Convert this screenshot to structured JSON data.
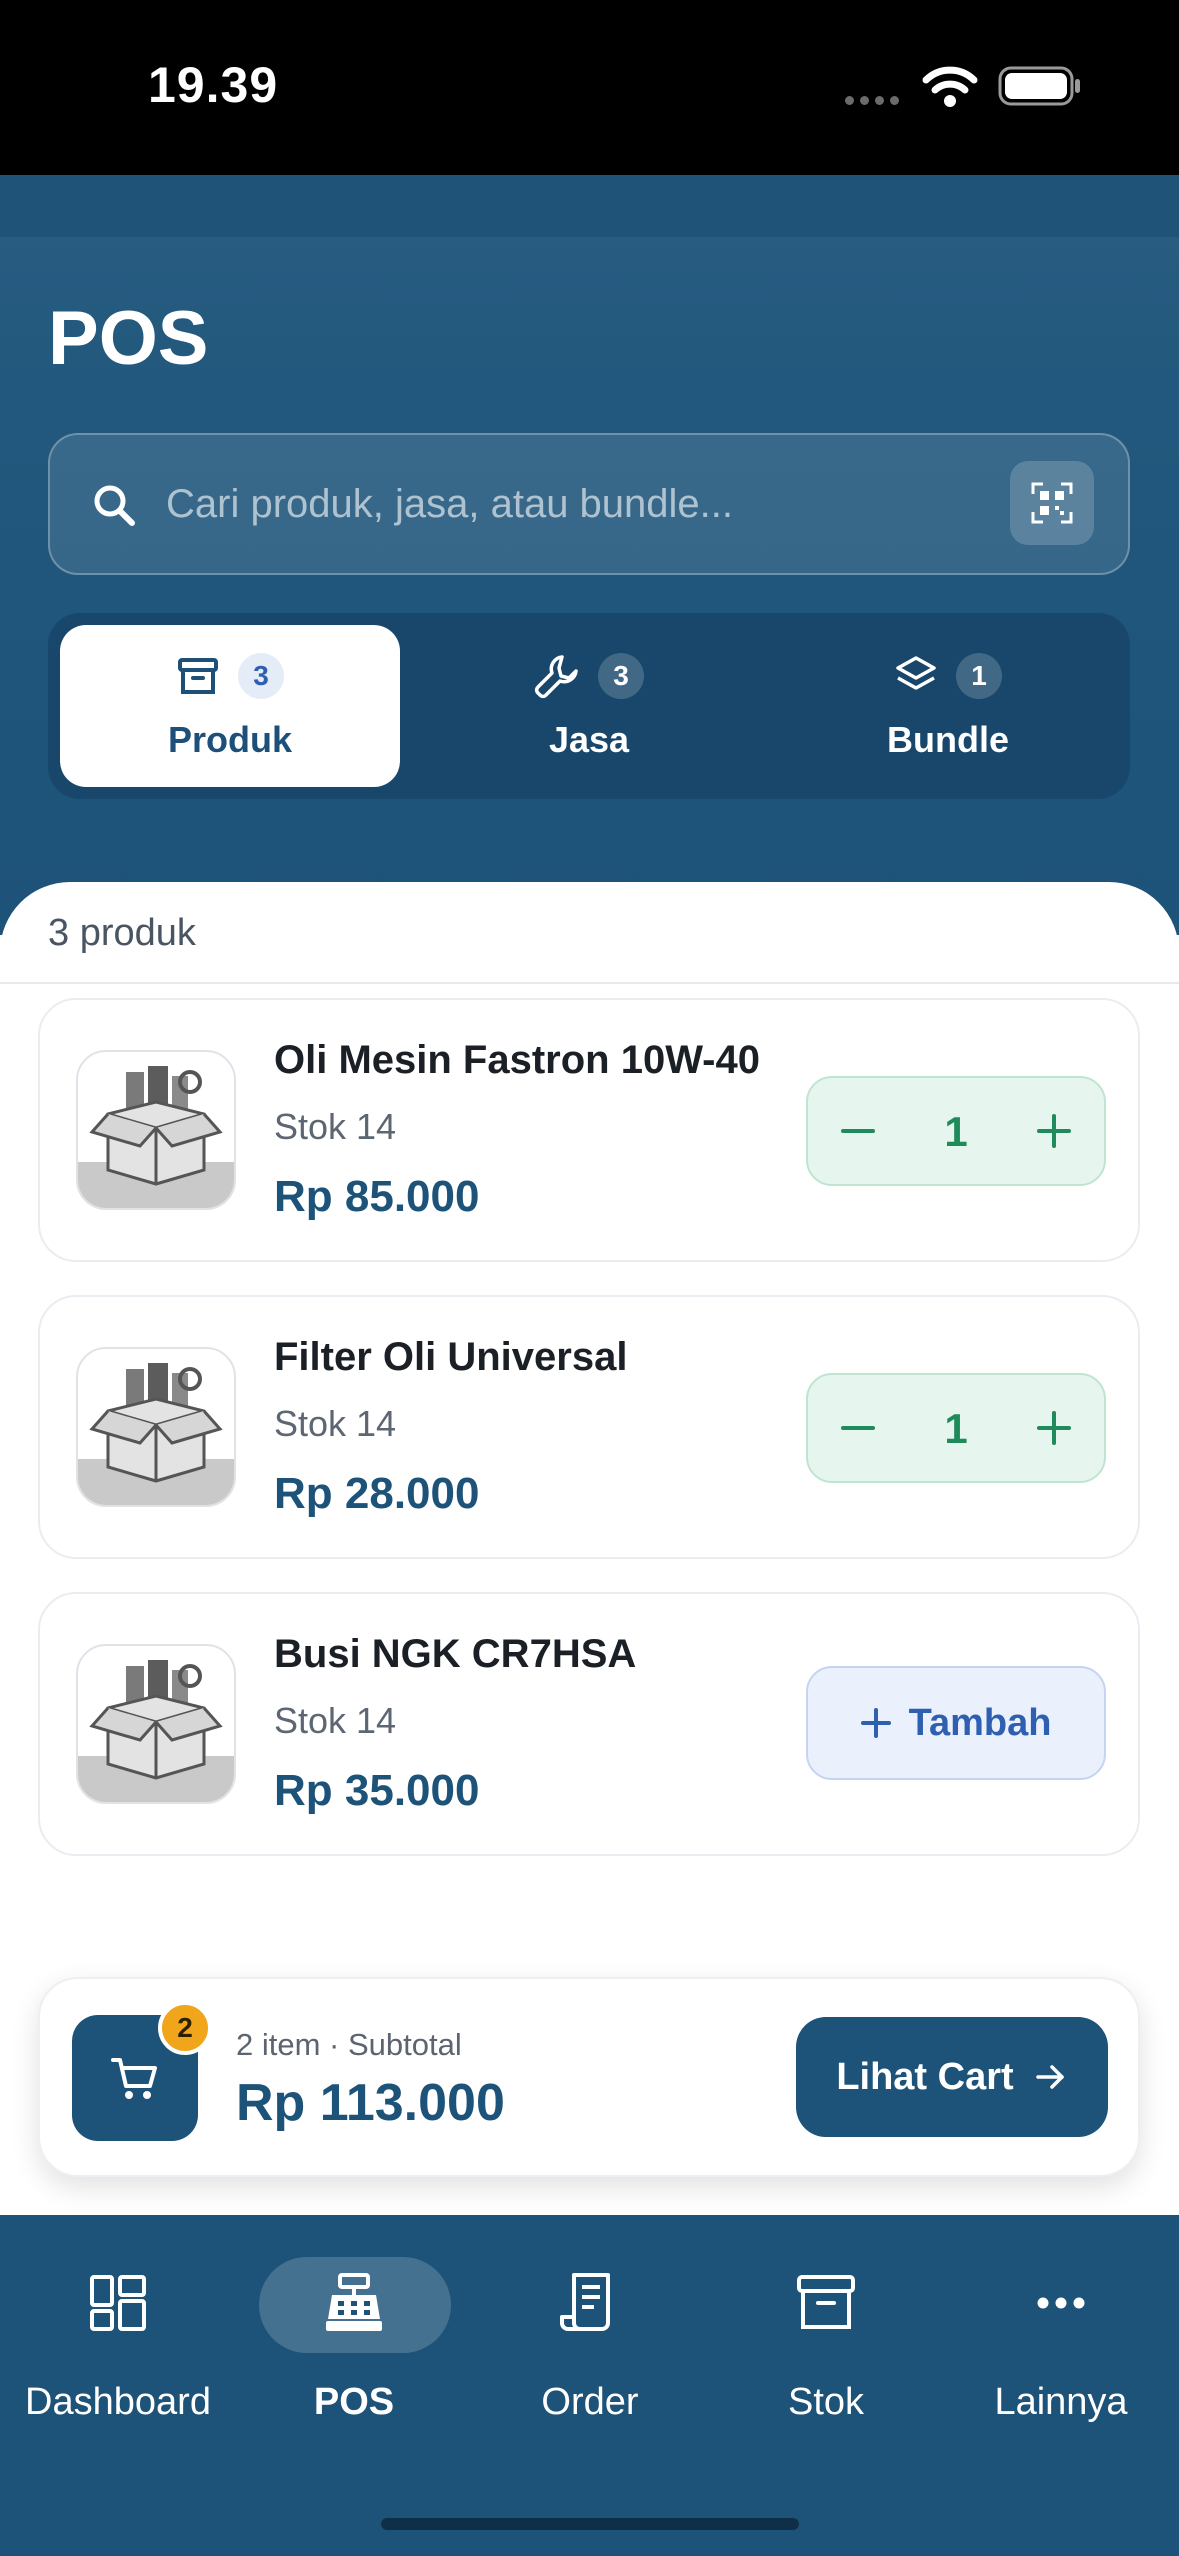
{
  "status_bar": {
    "time": "19.39"
  },
  "header": {
    "title": "POS"
  },
  "search": {
    "placeholder": "Cari produk, jasa, atau bundle..."
  },
  "tabs": [
    {
      "label": "Produk",
      "count": "3",
      "icon": "archive-box-icon",
      "active": true
    },
    {
      "label": "Jasa",
      "count": "3",
      "icon": "wrench-icon",
      "active": false
    },
    {
      "label": "Bundle",
      "count": "1",
      "icon": "layers-icon",
      "active": false
    }
  ],
  "list": {
    "count_label": "3 produk",
    "products": [
      {
        "name": "Oli Mesin Fastron 10W-40",
        "stock": "Stok 14",
        "price": "Rp 85.000",
        "qty": "1",
        "in_cart": true
      },
      {
        "name": "Filter Oli Universal",
        "stock": "Stok 14",
        "price": "Rp 28.000",
        "qty": "1",
        "in_cart": true
      },
      {
        "name": "Busi NGK CR7HSA",
        "stock": "Stok 14",
        "price": "Rp 35.000",
        "add_label": "Tambah",
        "in_cart": false
      }
    ]
  },
  "cart": {
    "badge": "2",
    "meta": "2 item · Subtotal",
    "total": "Rp 113.000",
    "button_label": "Lihat Cart"
  },
  "nav": [
    {
      "label": "Dashboard",
      "icon": "dashboard-icon",
      "active": false
    },
    {
      "label": "POS",
      "icon": "cash-register-icon",
      "active": true
    },
    {
      "label": "Order",
      "icon": "receipt-icon",
      "active": false
    },
    {
      "label": "Stok",
      "icon": "archive-box-icon",
      "active": false
    },
    {
      "label": "Lainnya",
      "icon": "more-dots-icon",
      "active": false
    }
  ],
  "colors": {
    "primary": "#1d5279",
    "accent_green": "#1f8a5a",
    "accent_blue": "#2f5fb0",
    "badge_orange": "#f0a51a"
  }
}
